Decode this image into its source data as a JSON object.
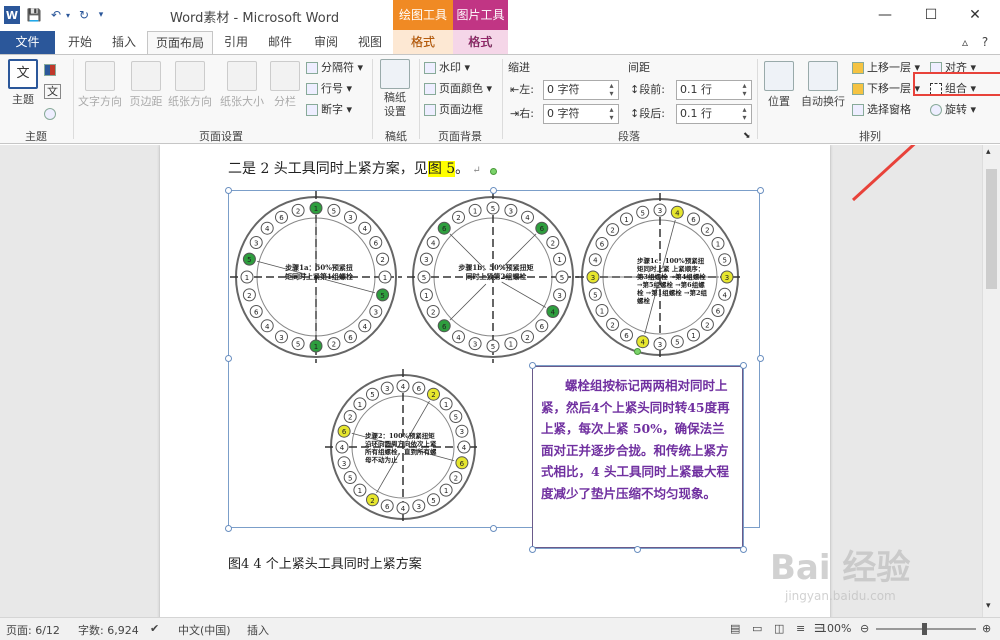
{
  "titlebar": {
    "app_icon": "word-icon",
    "title": "Word素材 - Microsoft Word",
    "context_tabs": [
      {
        "group": "绘图工具",
        "tab": "格式",
        "color": "#f08a24"
      },
      {
        "group": "图片工具",
        "tab": "格式",
        "color": "#c13584"
      }
    ],
    "help": "?"
  },
  "tabs": [
    "文件",
    "开始",
    "插入",
    "页面布局",
    "引用",
    "邮件",
    "审阅",
    "视图"
  ],
  "active_tab": "页面布局",
  "ribbon": {
    "theme_group": {
      "label": "主题",
      "theme_btn": "主题",
      "colors": "",
      "fonts": "文"
    },
    "page_setup": {
      "label": "页面设置",
      "buttons": [
        "文字方向",
        "页边距",
        "纸张方向",
        "纸张大小",
        "分栏"
      ],
      "small": [
        "分隔符",
        "行号",
        "断字"
      ]
    },
    "draft": {
      "label": "稿纸",
      "btn": "稿纸设置"
    },
    "page_bg": {
      "label": "页面背景",
      "watermark": "水印",
      "page_color": "页面颜色",
      "page_border": "页面边框"
    },
    "paragraph": {
      "label": "段落",
      "indent_title": "缩进",
      "spacing_title": "间距",
      "left_label": "左:",
      "left_value": "0 字符",
      "right_label": "右:",
      "right_value": "0 字符",
      "before_label": "段前:",
      "before_value": "0.1 行",
      "after_label": "段后:",
      "after_value": "0.1 行"
    },
    "arrange": {
      "label": "排列",
      "position": "位置",
      "wrap": "自动换行",
      "bring_forward": "上移一层",
      "send_backward": "下移一层",
      "selection_pane": "选择窗格",
      "align": "对齐",
      "group": "组合",
      "rotate": "旋转"
    }
  },
  "document": {
    "line1_prefix": "二是 2 头工具同时上紧方案，见",
    "line1_link": "图 5",
    "line1_suffix": "。",
    "figure_caption": "图4    4 个上紧头工具同时上紧方案",
    "dial_texts": [
      "步骤1a：50%预紧扭矩同时上紧第1组螺栓",
      "步骤1b：50%预紧扭矩同时上紧第2组螺栓",
      "步骤1c：100%预紧扭矩同时上紧 上紧顺序：第3组螺栓 →第4组螺栓 →第5组螺栓 →第6组螺栓 →第1组螺栓 →第2组螺栓",
      "步骤2：100%预紧扭矩沿环向圆周方向依次上紧所有组螺栓，直到所有螺母不动为止"
    ],
    "callout": "螺栓组按标记两两相对同时上紧，然后4个上紧头同时转45度再上紧，每次上紧 50%，确保法兰面对正并逐步合拢。和传统上紧方式相比，4 头工具同时上紧最大程度减少了垫片压缩不均匀现象。"
  },
  "statusbar": {
    "page": "页面: 6/12",
    "words": "字数: 6,924",
    "lang": "中文(中国)",
    "mode": "插入",
    "zoom": "100%"
  },
  "watermark": {
    "main": "Bai 经验",
    "sub": "jingyan.baidu.com"
  }
}
